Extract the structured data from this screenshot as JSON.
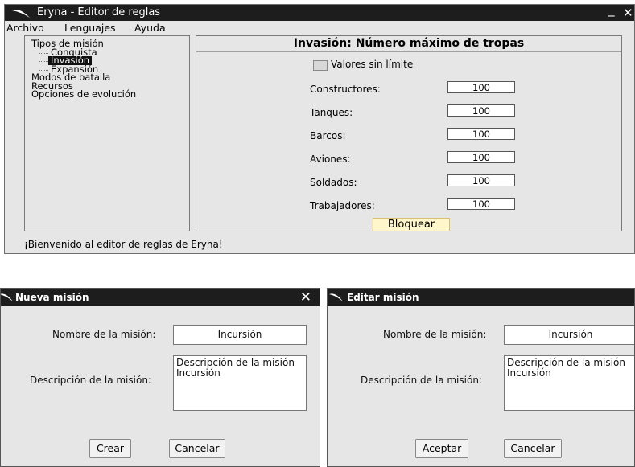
{
  "main_window": {
    "title": "Eryna - Editor de reglas",
    "minimize_glyph": "_",
    "close_glyph": "✕",
    "menu": [
      "Archivo",
      "Lenguajes",
      "Ayuda"
    ],
    "tree": {
      "root1": "Tipos de misión",
      "children": [
        "Conquista",
        "Invasión",
        "Expansión"
      ],
      "root2": "Modos de batalla",
      "root3": "Recursos",
      "root4": "Opciones de evolución"
    },
    "panel": {
      "heading": "Invasión: Número máximo de tropas",
      "unlimited_label": "Valores sin límite",
      "fields": [
        {
          "label": "Constructores:",
          "value": "100"
        },
        {
          "label": "Tanques:",
          "value": "100"
        },
        {
          "label": "Barcos:",
          "value": "100"
        },
        {
          "label": "Aviones:",
          "value": "100"
        },
        {
          "label": "Soldados:",
          "value": "100"
        },
        {
          "label": "Trabajadores:",
          "value": "100"
        }
      ],
      "lock_button": "Bloquear"
    },
    "status": "¡Bienvenido al editor de reglas de Eryna!"
  },
  "new_dialog": {
    "title": "Nueva misión",
    "close_glyph": "✕",
    "name_label": "Nombre de la misión:",
    "name_value": "Incursión",
    "desc_label": "Descripción de la misión:",
    "desc_value": "Descripción de la misión Incursión",
    "create_button": "Crear",
    "cancel_button": "Cancelar"
  },
  "edit_dialog": {
    "title": "Editar misión",
    "name_label": "Nombre de la misión:",
    "name_value": "Incursión",
    "desc_label": "Descripción de la misión:",
    "desc_value": "Descripción de la misión Incursión",
    "accept_button": "Aceptar",
    "cancel_button": "Cancelar"
  },
  "icons": {
    "app_logo": "feather-logo-icon"
  }
}
